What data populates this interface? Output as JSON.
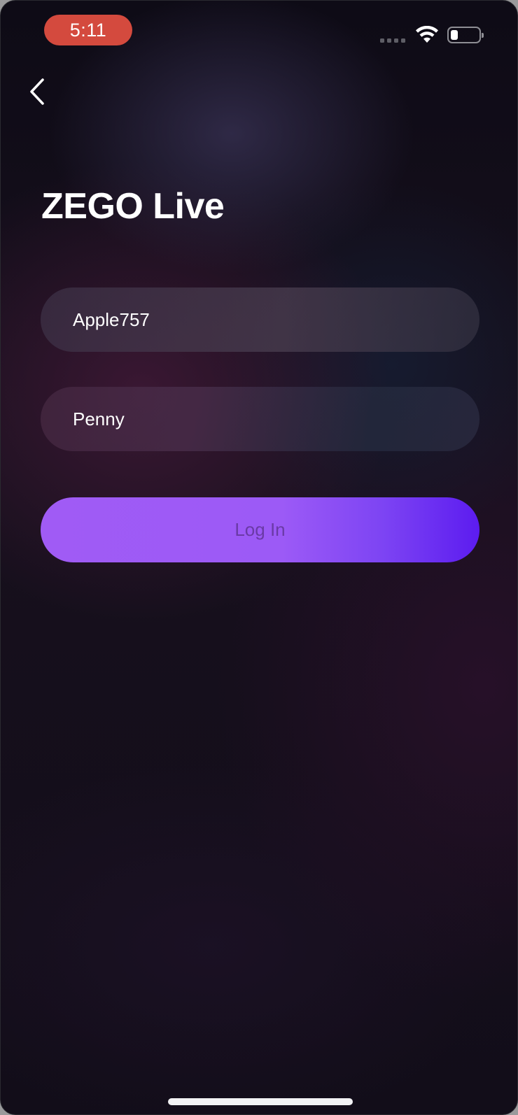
{
  "status_bar": {
    "time": "5:11",
    "signal_icon": "cellular-signal-icon",
    "wifi_icon": "wifi-icon",
    "battery_icon": "battery-icon",
    "time_pill_color": "#d44a3e"
  },
  "nav": {
    "back_icon": "chevron-left-icon"
  },
  "app": {
    "title": "ZEGO Live"
  },
  "form": {
    "user_id_value": "Apple757",
    "user_name_value": "Penny",
    "login_label": "Log In"
  },
  "colors": {
    "accent_start": "#a05bf5",
    "accent_end": "#5c1cf0",
    "background": "#0f0b17"
  }
}
